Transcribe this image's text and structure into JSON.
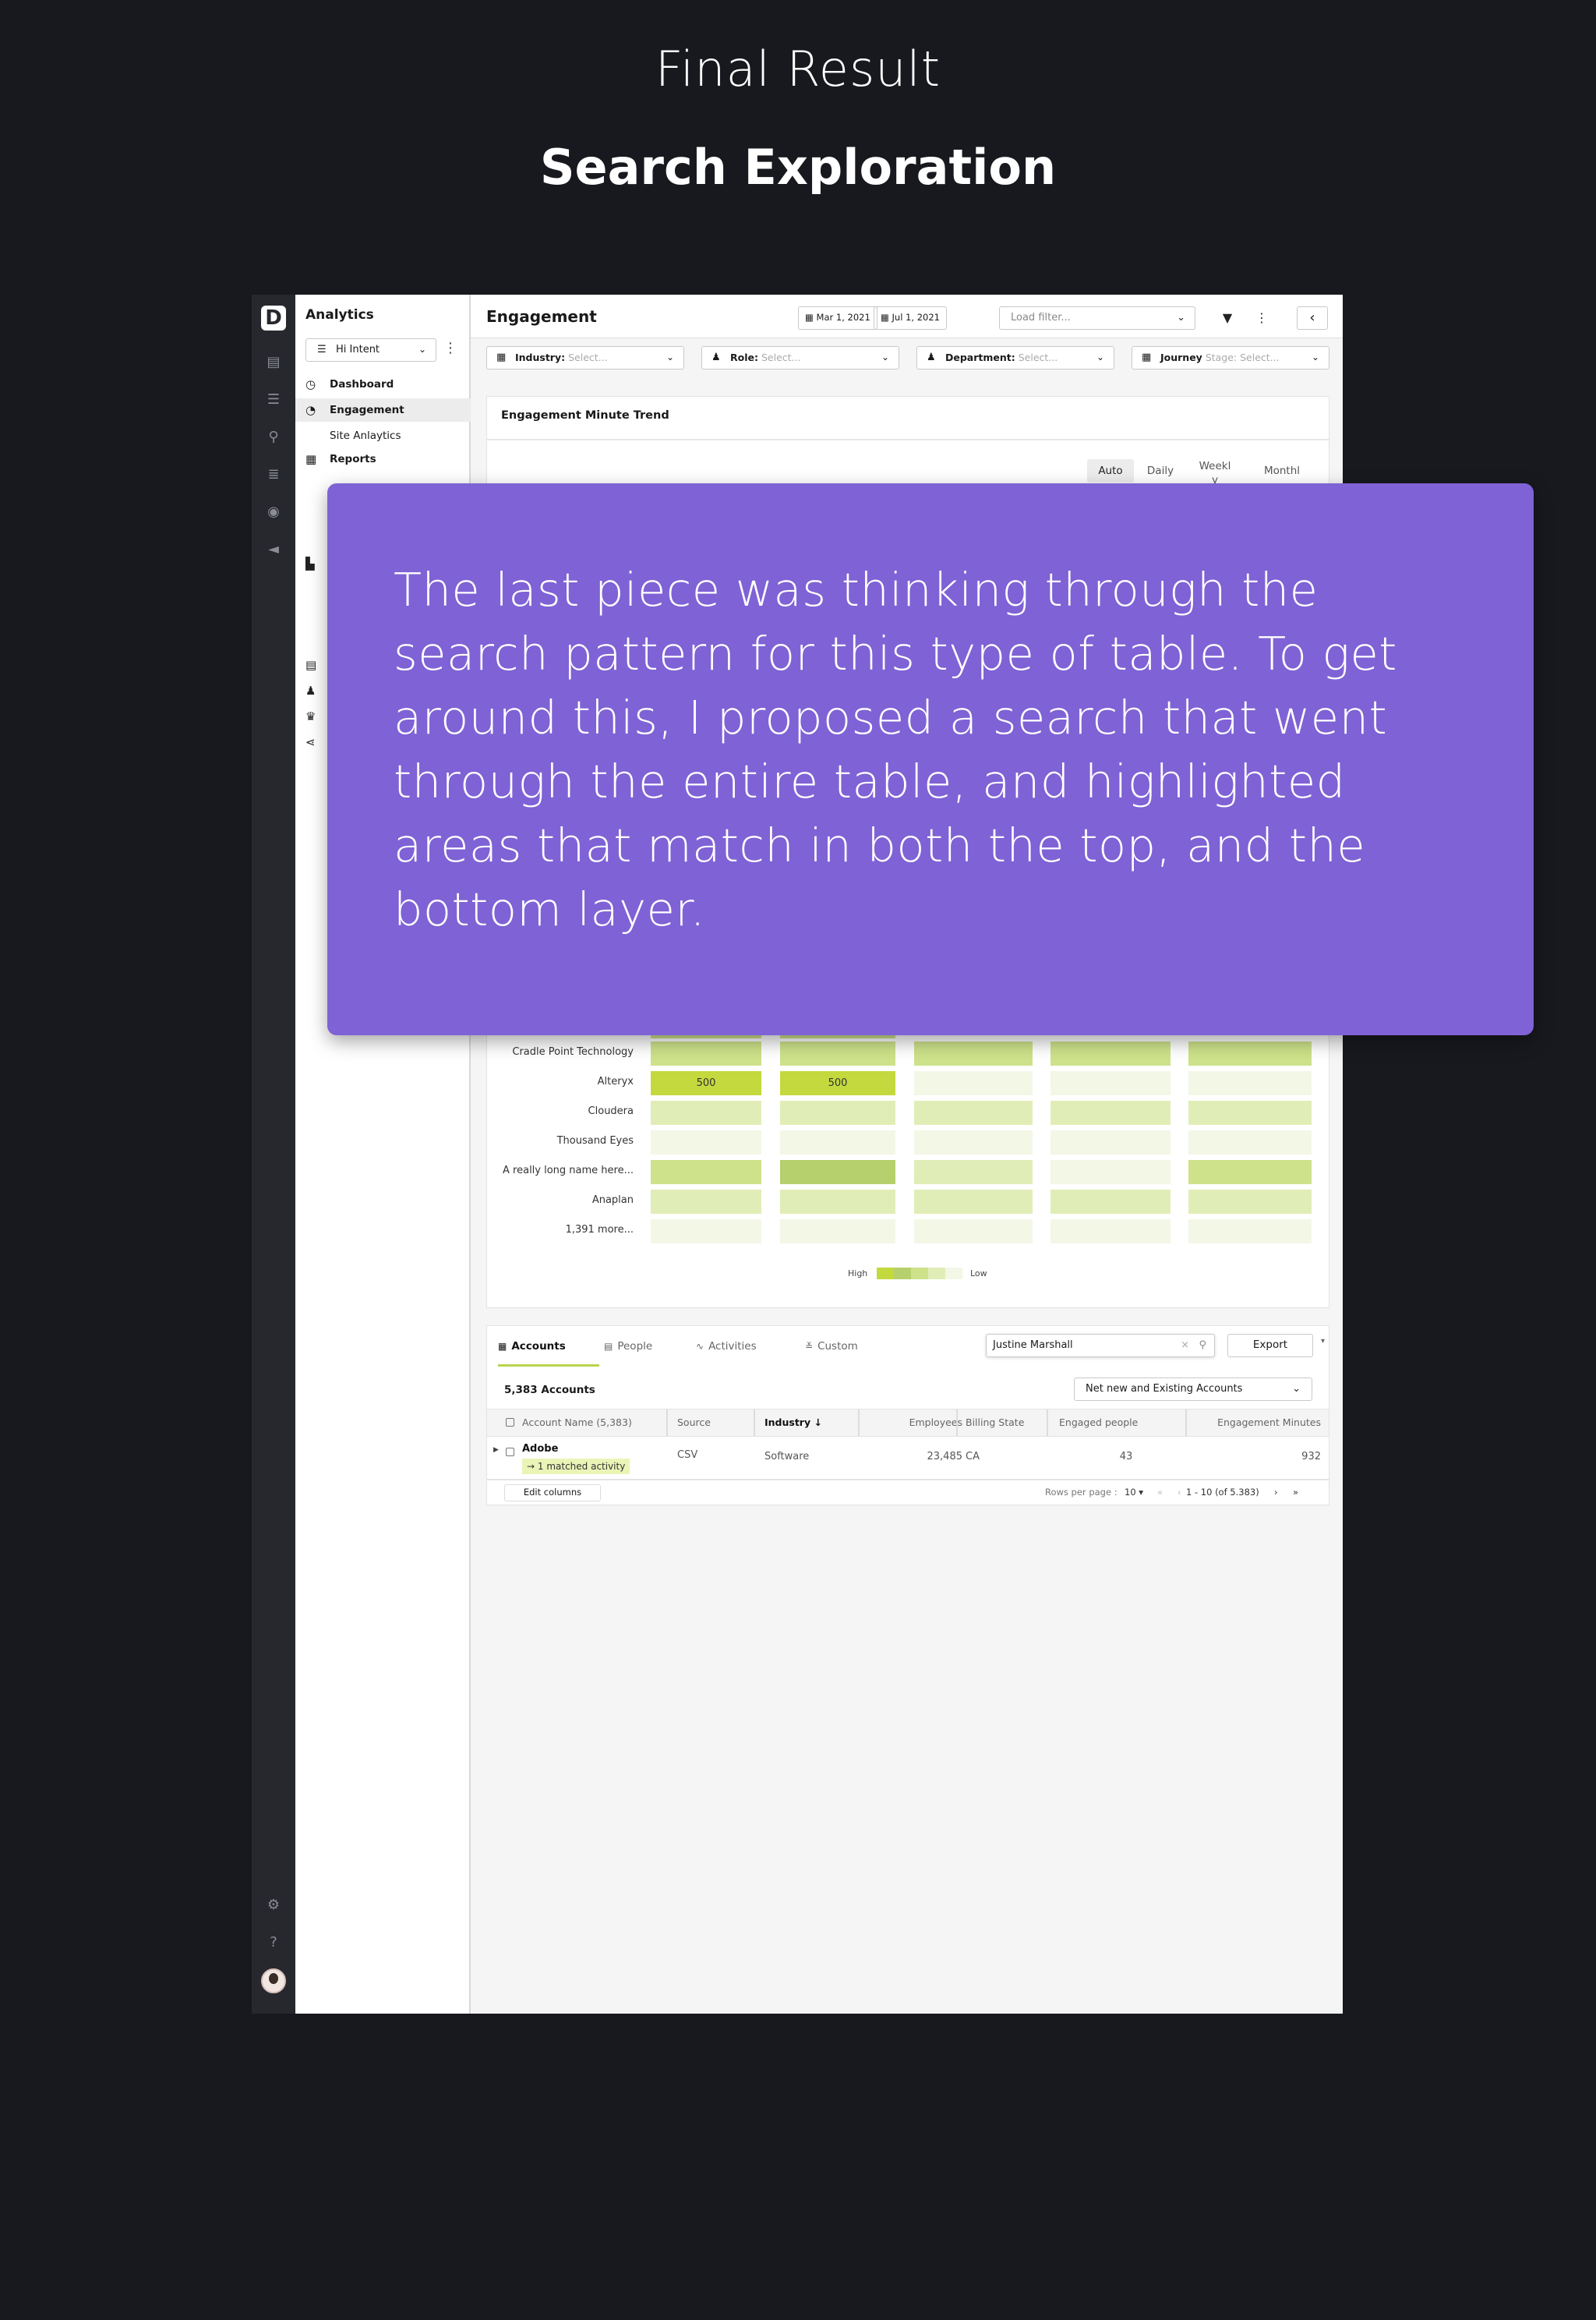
{
  "page": {
    "heading": "Final Result",
    "subheading": "Search Exploration"
  },
  "sidebar": {
    "title": "Analytics",
    "selector_value": "Hi Intent",
    "items": [
      {
        "label": "Dashboard",
        "icon": "clock-icon"
      },
      {
        "label": "Engagement",
        "icon": "stopwatch-icon"
      },
      {
        "label": "Site Anlaytics"
      },
      {
        "label": "Reports",
        "icon": "calendar-icon"
      }
    ]
  },
  "header": {
    "title": "Engagement",
    "start_date": "Mar 1, 2021",
    "end_date": "Jul 1, 2021",
    "load_filter_placeholder": "Load filter..."
  },
  "filters": [
    {
      "label": "Industry:",
      "placeholder": "Select..."
    },
    {
      "label": "Role:",
      "placeholder": "Select..."
    },
    {
      "label": "Department:",
      "placeholder": "Select..."
    },
    {
      "label": "Journey",
      "placeholder": "Stage: Select..."
    }
  ],
  "trend_card": {
    "title": "Engagement Minute Trend",
    "granularity_options": [
      "Auto",
      "Daily",
      "Weekl\ny",
      "Monthl"
    ],
    "selected_granularity": "Auto"
  },
  "heatmap": {
    "rows": [
      {
        "label": "Cradle Point Technology",
        "levels": [
          3,
          3,
          3,
          3,
          3
        ]
      },
      {
        "label": "Alteryx",
        "levels": [
          4,
          4,
          1,
          1,
          1
        ],
        "values": [
          "500",
          "500",
          "",
          "",
          ""
        ]
      },
      {
        "label": "Cloudera",
        "levels": [
          2,
          2,
          2,
          2,
          2
        ]
      },
      {
        "label": "Thousand Eyes",
        "levels": [
          1,
          1,
          1,
          1,
          1
        ]
      },
      {
        "label": "A really long name here...",
        "levels": [
          3,
          4,
          2,
          1,
          3
        ]
      },
      {
        "label": "Anaplan",
        "levels": [
          2,
          2,
          2,
          2,
          2
        ]
      },
      {
        "label": "1,391 more...",
        "levels": [
          1,
          1,
          1,
          1,
          1
        ]
      }
    ],
    "legend_high": "High",
    "legend_low": "Low",
    "scale_colors": [
      "#f3f7e6",
      "#e1edb7",
      "#cde28a",
      "#b5d06c",
      "#c3d93d"
    ]
  },
  "table": {
    "tabs": [
      "Accounts",
      "People",
      "Activities",
      "Custom"
    ],
    "active_tab": "Accounts",
    "search_value": "Justine Marshall",
    "export_label": "Export",
    "count_label": "5,383 Accounts",
    "segment_value": "Net new and Existing Accounts",
    "columns": [
      "Account Name (5,383)",
      "Source",
      "Industry",
      "Employees",
      "Billing State",
      "Engaged people",
      "Engagement Minutes"
    ],
    "sorted_column": "Industry",
    "rows": [
      {
        "account": "Adobe",
        "match": "1 matched activity",
        "source": "CSV",
        "industry": "Software",
        "employees": "23,485",
        "state": "CA",
        "engaged": "43",
        "minutes": "932"
      }
    ],
    "edit_columns_label": "Edit columns",
    "rows_per_page_label": "Rows per page :",
    "rows_per_page": "10",
    "range_label": "1 - 10 (of 5.383)"
  },
  "overlay": {
    "text": "The last piece was thinking through the search pattern for this type of table. To get around this, I proposed a search that went through the entire table, and highlighted areas that match in both the top, and the bottom layer."
  },
  "colors": {
    "background": "#17191e",
    "overlay": "#7f62d5",
    "accent": "#b9d54b",
    "rail": "#26282e"
  }
}
